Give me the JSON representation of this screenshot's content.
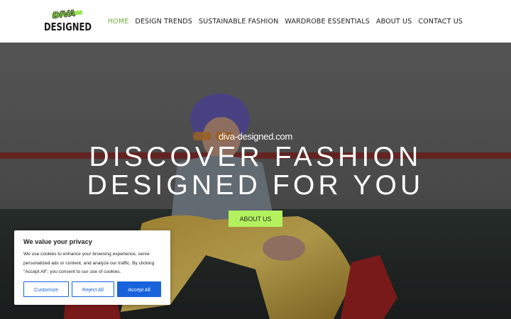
{
  "logo": {
    "top_text": "DIVA",
    "bottom_text": "DESIGNED"
  },
  "nav": {
    "items": [
      {
        "label": "HOME",
        "active": true
      },
      {
        "label": "DESIGN TRENDS"
      },
      {
        "label": "SUSTAINABLE FASHION"
      },
      {
        "label": "WARDROBE ESSENTIALS"
      },
      {
        "label": "ABOUT US"
      },
      {
        "label": "CONTACT US"
      }
    ]
  },
  "hero": {
    "site_url": "diva-designed.com",
    "headline_line1": "DISCOVER FASHION",
    "headline_line2": "DESIGNED FOR YOU",
    "button_label": "ABOUT US"
  },
  "cookie": {
    "title": "We value your privacy",
    "text": "We use cookies to enhance your browsing experience, serve personalized ads or content, and analyze our traffic. By clicking \"Accept All\", you consent to our use of cookies.",
    "customize_label": "Customize",
    "reject_label": "Reject All",
    "accept_label": "Accept All"
  },
  "colors": {
    "accent_green": "#6fae3f",
    "button_green": "#b3f25e",
    "cookie_blue": "#1863dc"
  }
}
